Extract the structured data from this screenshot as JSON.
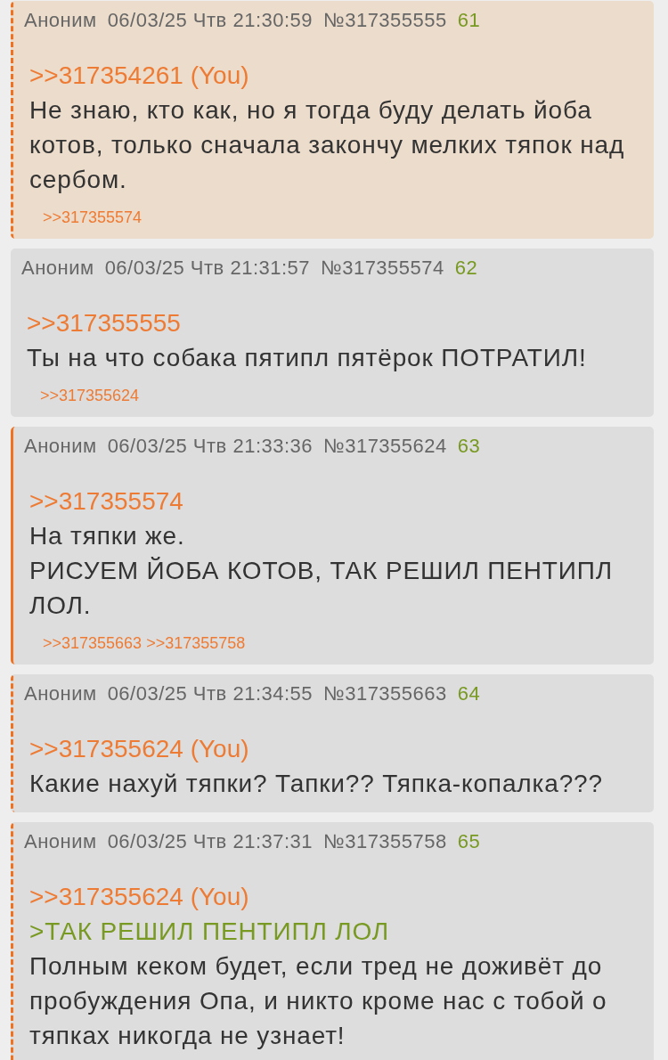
{
  "posts": [
    {
      "author": "Аноним",
      "date": "06/03/25 Чтв 21:30:59",
      "number": "№317355555",
      "ordinal": "61",
      "highlighted": true,
      "own_post": false,
      "reply_to_you": true,
      "lines": [
        {
          "kind": "reply",
          "text": ">>317354261",
          "you_label": "(You)"
        },
        {
          "kind": "text",
          "text": "Не знаю, кто как, но я тогда буду делать йоба котов, только сначала закончу мелких тяпок над сербом."
        }
      ],
      "backlinks": [
        ">>317355574"
      ]
    },
    {
      "author": "Аноним",
      "date": "06/03/25 Чтв 21:31:57",
      "number": "№317355574",
      "ordinal": "62",
      "highlighted": false,
      "own_post": false,
      "reply_to_you": false,
      "lines": [
        {
          "kind": "reply",
          "text": ">>317355555"
        },
        {
          "kind": "text",
          "text": "Ты на что собака пятипл пятёрок ПОТРАТИЛ!"
        }
      ],
      "backlinks": [
        ">>317355624"
      ]
    },
    {
      "author": "Аноним",
      "date": "06/03/25 Чтв 21:33:36",
      "number": "№317355624",
      "ordinal": "63",
      "highlighted": false,
      "own_post": true,
      "reply_to_you": false,
      "lines": [
        {
          "kind": "reply",
          "text": ">>317355574"
        },
        {
          "kind": "text",
          "text": "На тяпки же."
        },
        {
          "kind": "text",
          "text": "РИСУЕМ ЙОБА КОТОВ, ТАК РЕШИЛ ПЕНТИПЛ ЛОЛ."
        }
      ],
      "backlinks": [
        ">>317355663",
        ">>317355758"
      ]
    },
    {
      "author": "Аноним",
      "date": "06/03/25 Чтв 21:34:55",
      "number": "№317355663",
      "ordinal": "64",
      "highlighted": false,
      "own_post": false,
      "reply_to_you": true,
      "lines": [
        {
          "kind": "reply",
          "text": ">>317355624",
          "you_label": "(You)"
        },
        {
          "kind": "text",
          "text": "Какие нахуй тяпки? Тапки?? Тяпка-копалка???"
        }
      ]
    },
    {
      "author": "Аноним",
      "date": "06/03/25 Чтв 21:37:31",
      "number": "№317355758",
      "ordinal": "65",
      "highlighted": false,
      "own_post": false,
      "reply_to_you": true,
      "lines": [
        {
          "kind": "reply",
          "text": ">>317355624",
          "you_label": "(You)"
        },
        {
          "kind": "quote",
          "text": ">ТАК РЕШИЛ ПЕНТИПЛ ЛОЛ"
        },
        {
          "kind": "text",
          "text": "Полным кеком будет, если тред не доживёт до пробуждения Опа, и никто кроме нас с тобой о тяпках никогда не узнает!"
        }
      ]
    }
  ]
}
